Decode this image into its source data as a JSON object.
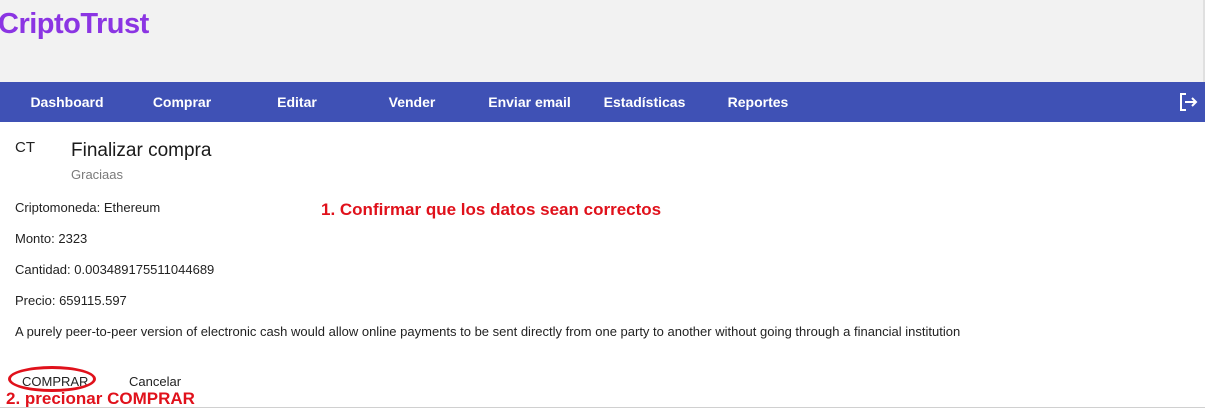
{
  "app": {
    "brand": "CriptoTrust"
  },
  "nav": {
    "items": [
      {
        "label": "Dashboard"
      },
      {
        "label": "Comprar"
      },
      {
        "label": "Editar"
      },
      {
        "label": "Vender"
      },
      {
        "label": "Enviar email"
      },
      {
        "label": "Estadísticas"
      },
      {
        "label": "Reportes"
      }
    ],
    "logout_icon": "logout-icon"
  },
  "card": {
    "avatar": "CT",
    "title": "Finalizar compra",
    "subtitle": "Graciaas",
    "details": [
      "Criptomoneda: Ethereum",
      "Monto: 2323",
      "Cantidad: 0.003489175511044689",
      "Precio: 659115.597"
    ],
    "description": "A purely peer-to-peer version of electronic cash would allow online payments to be sent directly from one party to another without going through a financial institution",
    "actions": {
      "buy": "COMPRAR",
      "cancel": "Cancelar"
    }
  },
  "annotations": {
    "step1": "1. Confirmar que los datos sean correctos",
    "step2": "2. precionar COMPRAR"
  },
  "colors": {
    "brand": "#8b35e3",
    "navbar": "#3f51b5",
    "annotation": "#e0111b"
  }
}
